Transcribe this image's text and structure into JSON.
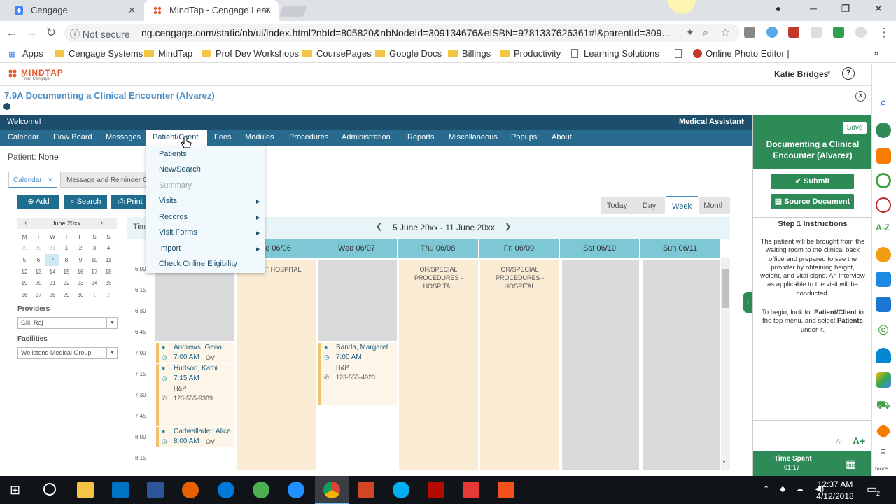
{
  "browser": {
    "tabs": [
      {
        "title": "Cengage",
        "active": false
      },
      {
        "title": "MindTap - Cengage Lear",
        "active": true
      }
    ],
    "security": "Not secure",
    "url": "ng.cengage.com/static/nb/ui/index.html?nbId=805820&nbNodeId=309134676&eISBN=9781337626361#!&parentId=309...",
    "bookmarks": [
      "Apps",
      "Cengage Systems",
      "MindTap",
      "Prof Dev Workshops",
      "CoursePages",
      "Google Docs",
      "Billings",
      "Productivity",
      "Learning Solutions C",
      "Online Photo Editor |"
    ]
  },
  "mindtap": {
    "logo": "MINDTAP",
    "logo_sub": "From Cengage",
    "user": "Katie Bridges",
    "activity_title": "7.9A Documenting a Clinical Encounter (Alvarez)"
  },
  "app": {
    "welcome": "Welcome!",
    "role": "Medical Assistant",
    "menu": [
      "Calendar",
      "Flow Board",
      "Messages",
      "Patient/Client",
      "Fees",
      "Modules",
      "Procedures",
      "Administration",
      "Reports",
      "Miscellaneous",
      "Popups",
      "About"
    ],
    "patient_label": "Patient:",
    "patient_value": "None",
    "tabs": [
      {
        "label": "Calendar"
      },
      {
        "label": "Message and Reminder C"
      }
    ],
    "dropdown": [
      {
        "label": "Patients",
        "arrow": false,
        "disabled": false
      },
      {
        "label": "New/Search",
        "arrow": false,
        "disabled": false
      },
      {
        "label": "Summary",
        "arrow": false,
        "disabled": true
      },
      {
        "label": "Visits",
        "arrow": true,
        "disabled": false
      },
      {
        "label": "Records",
        "arrow": true,
        "disabled": false
      },
      {
        "label": "Visit Forms",
        "arrow": true,
        "disabled": false
      },
      {
        "label": "Import",
        "arrow": true,
        "disabled": false
      },
      {
        "label": "Check Online Eligibility",
        "arrow": false,
        "disabled": false
      }
    ],
    "buttons": {
      "add": "Add",
      "search": "Search",
      "print": "Print"
    },
    "view_buttons": [
      "Today",
      "Day",
      "Week",
      "Month"
    ],
    "active_view": "Week",
    "date_range": "5 June 20xx - 11 June 20xx",
    "time_col_label": "Tim",
    "mini_calendar": {
      "month": "June 20xx",
      "weekdays": [
        "M",
        "T",
        "W",
        "T",
        "F",
        "S",
        "S"
      ],
      "weeks": [
        [
          "29",
          "30",
          "31",
          "1",
          "2",
          "3",
          "4"
        ],
        [
          "5",
          "6",
          "7",
          "8",
          "9",
          "10",
          "11"
        ],
        [
          "12",
          "13",
          "14",
          "15",
          "16",
          "17",
          "18"
        ],
        [
          "19",
          "20",
          "21",
          "22",
          "23",
          "24",
          "25"
        ],
        [
          "26",
          "27",
          "28",
          "29",
          "30",
          "1",
          "2"
        ]
      ],
      "today": "7"
    },
    "providers_label": "Providers",
    "provider": "Gill, Raj",
    "facilities_label": "Facilities",
    "facility": "Wellstone Medical Group",
    "day_headers": [
      "ue 06/06",
      "Wed 06/07",
      "Thu 06/08",
      "Fri 06/09",
      "Sat 06/10",
      "Sun 06/11"
    ],
    "times": [
      "6:00",
      "6:15",
      "6:30",
      "6:45",
      "7:00",
      "7:15",
      "7:30",
      "7:45",
      "8:00",
      "8:15"
    ],
    "events": {
      "tue": "AB AT HOSPITAL",
      "thu": "OR/SPECIAL PROCEDURES - HOSPITAL",
      "fri": "OR/SPECIAL PROCEDURES - HOSPITAL"
    },
    "appointments": [
      {
        "name": "Andrews, Gena",
        "time": "7:00 AM",
        "type": "OV"
      },
      {
        "name": "Hudson, Kathi",
        "time": "7:15 AM",
        "type": "H&P",
        "phone": "123-555-9389"
      },
      {
        "name": "Cadwallader, Alice",
        "time": "8:00 AM",
        "type": "OV"
      },
      {
        "name": "Banda, Margaret",
        "time": "7:00 AM",
        "type": "H&P",
        "phone": "123-555-4923"
      }
    ]
  },
  "panel": {
    "save": "Save",
    "title": "Documenting a Clinical Encounter (Alvarez)",
    "submit": "Submit",
    "source": "Source Document",
    "step_title": "Step 1 Instructions",
    "instructions": "The patient will be brought from the waiting room to the clinical back office and prepared to see the provider by obtaining height, weight, and vital signs. An interview as applicable to the visit will be conducted.",
    "to_begin_pre": "To begin, look for",
    "to_begin_b1": "Patient/Client",
    "to_begin_mid": "in the top menu, and select",
    "to_begin_b2": "Patients",
    "to_begin_post": "under it.",
    "font_small": "A-",
    "font_large": "A+",
    "time_spent_label": "Time Spent",
    "time_spent": "01:17",
    "more": "more"
  },
  "taskbar": {
    "time": "12:37 AM",
    "date": "4/12/2018",
    "notif": "2"
  },
  "colors": {
    "header_dark": "#1d4e6b",
    "menu": "#296b8e",
    "teal_button": "#1f6d8f",
    "green": "#2e8b57",
    "column_head": "#7ec8d6",
    "procedure_bg": "#faebd4"
  }
}
